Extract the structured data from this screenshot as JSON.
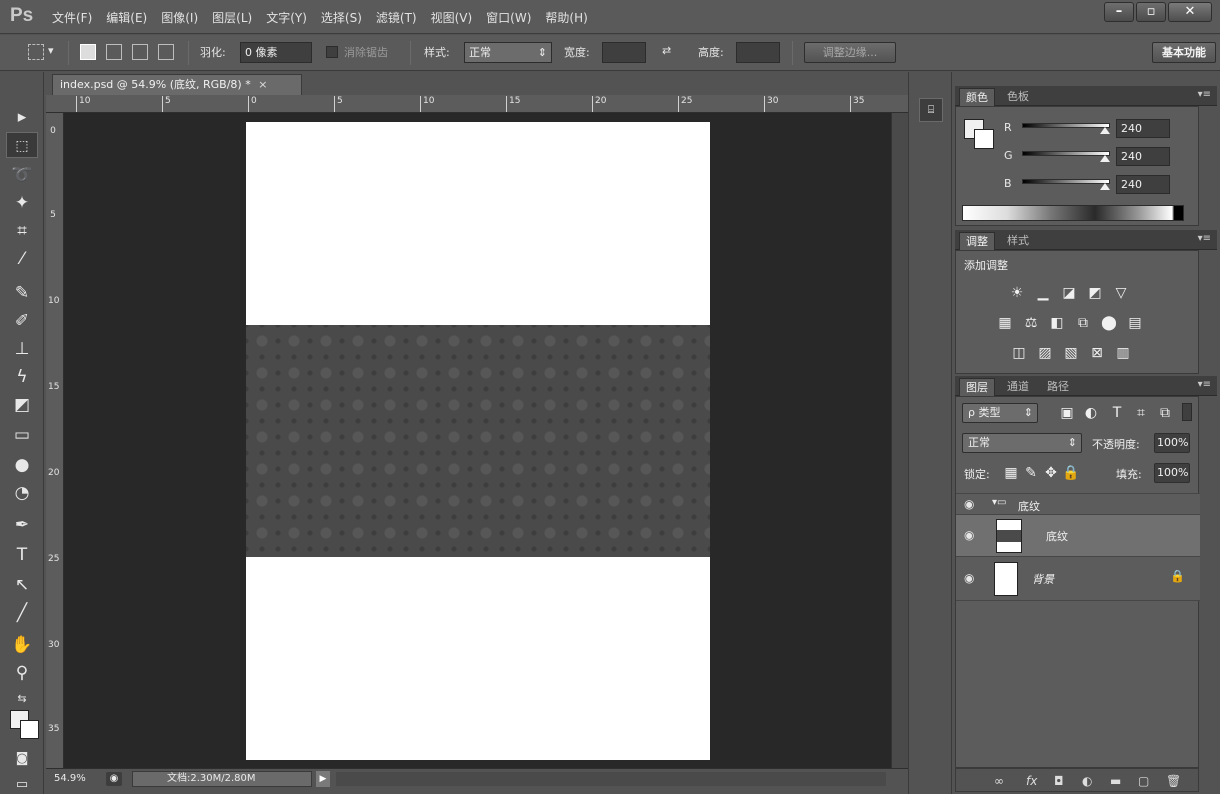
{
  "app": {
    "logo": "Ps"
  },
  "menu": [
    "文件(F)",
    "编辑(E)",
    "图像(I)",
    "图层(L)",
    "文字(Y)",
    "选择(S)",
    "滤镜(T)",
    "视图(V)",
    "窗口(W)",
    "帮助(H)"
  ],
  "window_controls": {
    "minimize": "–",
    "restore": "▫",
    "close": "✕"
  },
  "options": {
    "feather_label": "羽化:",
    "feather_value": "0 像素",
    "antialias_label": "消除锯齿",
    "style_label": "样式:",
    "style_value": "正常",
    "width_label": "宽度:",
    "height_label": "高度:",
    "refine_button": "调整边缘...",
    "workspace_button": "基本功能"
  },
  "document": {
    "tab_title": "index.psd @ 54.9% (底纹, RGB/8) *",
    "close": "×"
  },
  "ruler": {
    "h_ticks": [
      "10",
      "5",
      "0",
      "5",
      "10",
      "15",
      "20",
      "25",
      "30",
      "35"
    ],
    "v_ticks": [
      "0",
      "5",
      "10",
      "15",
      "20",
      "25",
      "30",
      "35"
    ]
  },
  "status": {
    "zoom": "54.9%",
    "doc_info": "文档:2.30M/2.80M",
    "arrow": "▶"
  },
  "color_panel": {
    "tabs": [
      "颜色",
      "色板"
    ],
    "channels": [
      {
        "label": "R",
        "value": "240",
        "level": 0.94
      },
      {
        "label": "G",
        "value": "240",
        "level": 0.94
      },
      {
        "label": "B",
        "value": "240",
        "level": 0.94
      }
    ]
  },
  "adjust_panel": {
    "tabs": [
      "调整",
      "样式"
    ],
    "title": "添加调整"
  },
  "layers_panel": {
    "tabs": [
      "图层",
      "通道",
      "路径"
    ],
    "filter_kind": "ρ 类型",
    "blend_mode": "正常",
    "opacity_label": "不透明度:",
    "opacity_value": "100%",
    "lock_label": "锁定:",
    "fill_label": "填充:",
    "fill_value": "100%",
    "layers": [
      {
        "name": "底纹",
        "type": "group"
      },
      {
        "name": "底纹",
        "type": "layer",
        "selected": true
      },
      {
        "name": "背景",
        "type": "background"
      }
    ]
  },
  "colors": {
    "accent_bg": "#535353",
    "canvas_bg": "#282828",
    "pattern_band": "#4a4a4a"
  }
}
